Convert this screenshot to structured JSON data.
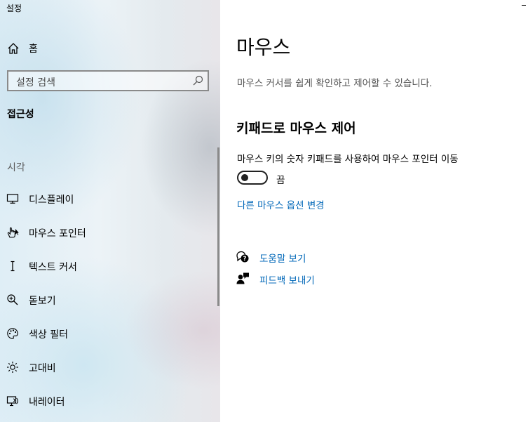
{
  "window": {
    "title": "설정"
  },
  "sidebar": {
    "home_label": "홈",
    "search_placeholder": "설정 검색",
    "section_title": "접근성",
    "group_label": "시각",
    "items": [
      {
        "label": "디스플레이",
        "icon": "monitor-icon"
      },
      {
        "label": "마우스 포인터",
        "icon": "mouse-pointer-icon"
      },
      {
        "label": "텍스트 커서",
        "icon": "text-cursor-icon"
      },
      {
        "label": "돋보기",
        "icon": "magnifier-icon"
      },
      {
        "label": "색상 필터",
        "icon": "palette-icon"
      },
      {
        "label": "고대비",
        "icon": "brightness-icon"
      },
      {
        "label": "내레이터",
        "icon": "narrator-icon"
      }
    ]
  },
  "main": {
    "title": "마우스",
    "description": "마우스 커서를 쉽게 확인하고 제어할 수 있습니다.",
    "section_title": "키패드로 마우스 제어",
    "setting_label": "마우스 키의 숫자 키패드를 사용하여 마우스 포인터 이동",
    "toggle_state": "끔",
    "toggle_on": false,
    "link_label": "다른 마우스 옵션 변경",
    "help_label": "도움말 보기",
    "feedback_label": "피드백 보내기"
  },
  "colors": {
    "accent_link": "#0067b8",
    "toggle_border": "#222222"
  }
}
